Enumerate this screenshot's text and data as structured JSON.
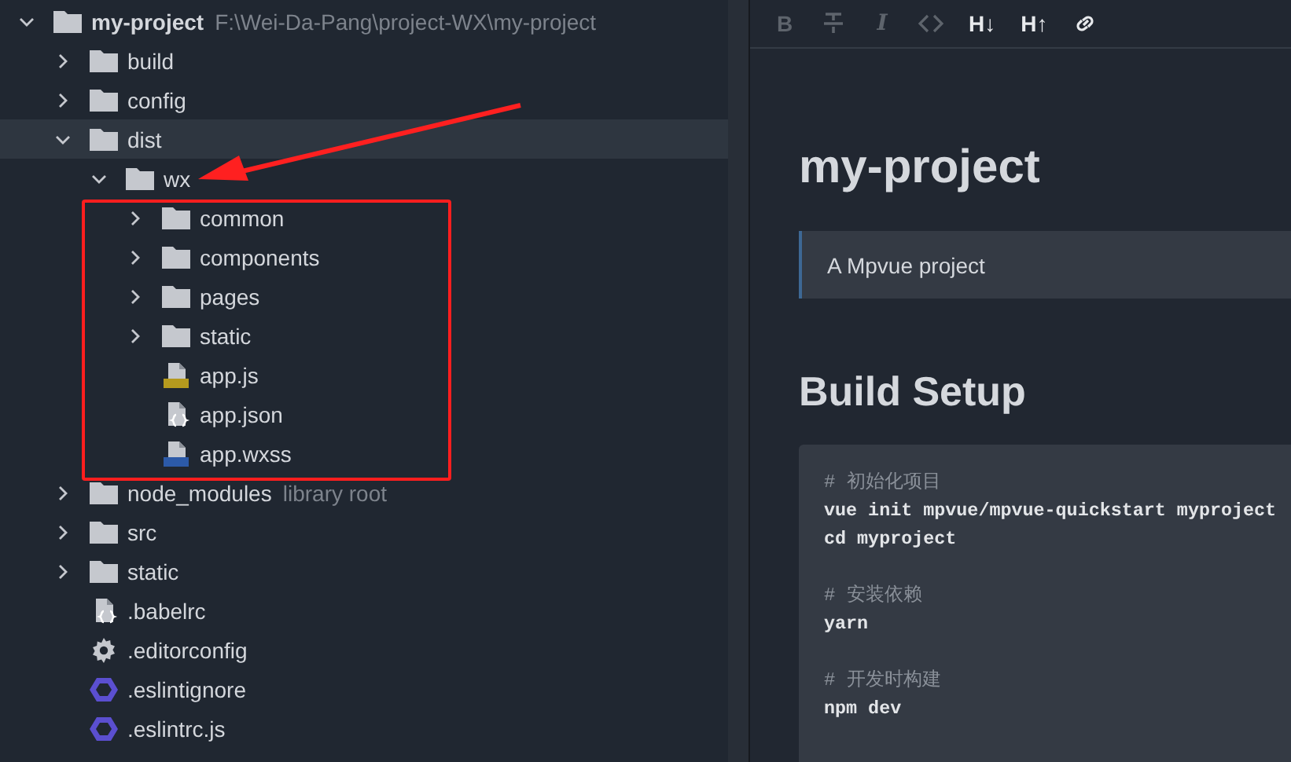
{
  "project_tree": {
    "items": [
      {
        "kind": "folder",
        "label": "my-project",
        "path": "F:\\Wei-Da-Pang\\project-WX\\my-project",
        "expanded": true,
        "selected": false,
        "children": [
          {
            "kind": "folder",
            "label": "build",
            "expanded": false,
            "selected": false
          },
          {
            "kind": "folder",
            "label": "config",
            "expanded": false,
            "selected": false
          },
          {
            "kind": "folder",
            "label": "dist",
            "expanded": true,
            "selected": true,
            "children": [
              {
                "kind": "folder",
                "label": "wx",
                "expanded": true,
                "selected": false,
                "children": [
                  {
                    "kind": "folder",
                    "label": "common",
                    "expanded": false,
                    "selected": false
                  },
                  {
                    "kind": "folder",
                    "label": "components",
                    "expanded": false,
                    "selected": false
                  },
                  {
                    "kind": "folder",
                    "label": "pages",
                    "expanded": false,
                    "selected": false
                  },
                  {
                    "kind": "folder",
                    "label": "static",
                    "expanded": false,
                    "selected": false
                  },
                  {
                    "kind": "js",
                    "label": "app.js",
                    "selected": false
                  },
                  {
                    "kind": "json",
                    "label": "app.json",
                    "selected": false
                  },
                  {
                    "kind": "wxss",
                    "label": "app.wxss",
                    "selected": false
                  }
                ]
              }
            ]
          },
          {
            "kind": "folder",
            "label": "node_modules",
            "note": "library root",
            "expanded": false,
            "selected": false
          },
          {
            "kind": "folder",
            "label": "src",
            "expanded": false,
            "selected": false
          },
          {
            "kind": "folder",
            "label": "static",
            "expanded": false,
            "selected": false
          },
          {
            "kind": "json",
            "label": ".babelrc",
            "selected": false
          },
          {
            "kind": "config",
            "label": ".editorconfig",
            "selected": false
          },
          {
            "kind": "eslint",
            "label": ".eslintignore",
            "selected": false
          },
          {
            "kind": "eslint",
            "label": ".eslintrc.js",
            "selected": false
          }
        ]
      }
    ]
  },
  "toolbar": [
    {
      "kind": "text",
      "label": "B",
      "disabled": true
    },
    {
      "kind": "strikethrough",
      "disabled": true
    },
    {
      "kind": "italic",
      "label": "I",
      "disabled": true
    },
    {
      "kind": "code",
      "disabled": true
    },
    {
      "kind": "text",
      "label": "H↓",
      "disabled": false
    },
    {
      "kind": "text",
      "label": "H↑",
      "disabled": false
    },
    {
      "kind": "link",
      "disabled": false
    }
  ],
  "document": {
    "title": "my-project",
    "blockquote": "A Mpvue project",
    "heading": "Build Setup",
    "code_lines": [
      {
        "kind": "comment",
        "text": "# 初始化项目"
      },
      {
        "kind": "command",
        "text": "vue init mpvue/mpvue-quickstart myproject"
      },
      {
        "kind": "command",
        "text": "cd myproject"
      },
      {
        "kind": "blank"
      },
      {
        "kind": "comment",
        "text": "# 安装依赖"
      },
      {
        "kind": "command",
        "text": "yarn"
      },
      {
        "kind": "blank"
      },
      {
        "kind": "comment",
        "text": "# 开发时构建"
      },
      {
        "kind": "command",
        "text": "npm dev"
      }
    ]
  },
  "annotations": {
    "highlight_rectangle": true,
    "pointer_arrow": true
  }
}
